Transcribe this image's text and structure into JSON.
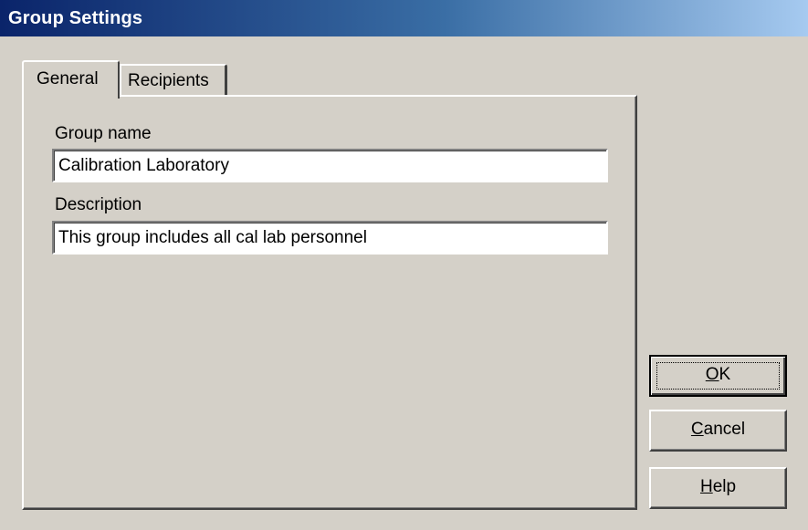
{
  "window": {
    "title": "Group Settings"
  },
  "tabs": [
    {
      "label": "General",
      "selected": true
    },
    {
      "label": "Recipients",
      "selected": false
    }
  ],
  "form": {
    "group_name_label": "Group name",
    "group_name_value": "Calibration Laboratory",
    "description_label": "Description",
    "description_value": "This group includes all cal lab personnel"
  },
  "buttons": {
    "ok_mnemonic": "O",
    "ok_rest": "K",
    "cancel_mnemonic": "C",
    "cancel_rest": "ancel",
    "help_mnemonic": "H",
    "help_rest": "elp"
  },
  "colors": {
    "dialog_face": "#d4d0c8",
    "title_gradient_start": "#0a246a",
    "title_gradient_end": "#a6caf0",
    "title_text": "#ffffff"
  }
}
